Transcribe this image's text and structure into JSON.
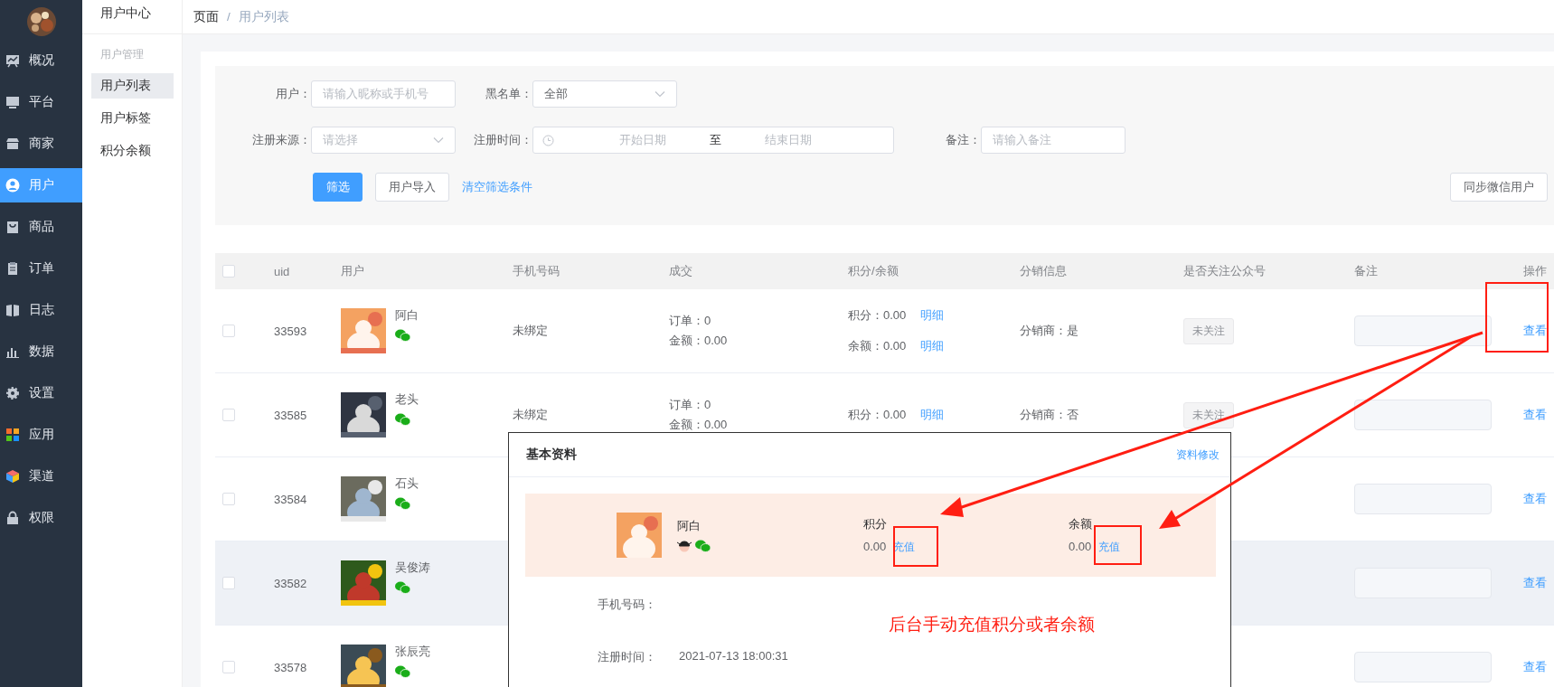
{
  "sidebar": {
    "items": [
      {
        "label": "概况",
        "kind": "chart",
        "selected": false
      },
      {
        "label": "平台",
        "kind": "monitor",
        "selected": false
      },
      {
        "label": "商家",
        "kind": "shop",
        "selected": false
      },
      {
        "label": "用户",
        "kind": "user",
        "selected": true
      },
      {
        "label": "商品",
        "kind": "bag",
        "selected": false
      },
      {
        "label": "订单",
        "kind": "clipboard",
        "selected": false
      },
      {
        "label": "日志",
        "kind": "book",
        "selected": false
      },
      {
        "label": "数据",
        "kind": "bars",
        "selected": false
      },
      {
        "label": "设置",
        "kind": "gear",
        "selected": false
      },
      {
        "label": "应用",
        "kind": "apps",
        "selected": false
      },
      {
        "label": "渠道",
        "kind": "cube",
        "selected": false
      },
      {
        "label": "权限",
        "kind": "lock",
        "selected": false
      }
    ]
  },
  "submenu": {
    "title": "用户中心",
    "group": "用户管理",
    "items": [
      {
        "label": "用户列表",
        "selected": true
      },
      {
        "label": "用户标签",
        "selected": false
      },
      {
        "label": "积分余额",
        "selected": false
      }
    ]
  },
  "breadcrumb": {
    "items": [
      "页面",
      "用户列表"
    ],
    "separator": "/"
  },
  "filters": {
    "rows": [
      [
        {
          "label": "用户：",
          "kind": "input",
          "placeholder": "请输入昵称或手机号"
        },
        {
          "label": "黑名单：",
          "kind": "select",
          "value": "全部"
        }
      ],
      [
        {
          "label": "注册来源：",
          "kind": "select",
          "placeholder": "请选择"
        },
        {
          "label": "注册时间：",
          "kind": "daterange",
          "start_placeholder": "开始日期",
          "separator": "至",
          "end_placeholder": "结束日期"
        },
        {
          "label": "备注：",
          "kind": "input",
          "placeholder": "请输入备注"
        }
      ]
    ],
    "buttons": [
      {
        "label": "筛选",
        "kind": "primary"
      },
      {
        "label": "用户导入",
        "kind": "default"
      },
      {
        "label": "清空筛选条件",
        "kind": "link"
      }
    ],
    "sync_button": "同步微信用户"
  },
  "table": {
    "select_all": {
      "checked": false
    },
    "columns": [
      "uid",
      "用户",
      "手机号码",
      "成交",
      "积分/余额",
      "分销信息",
      "是否关注公众号",
      "备注",
      "操作"
    ],
    "rows": [
      {
        "checked": false,
        "hovered": false,
        "uid": "33593",
        "name": "阿白",
        "phone": "未绑定",
        "orders": "订单：0",
        "amount": "金额：0.00",
        "points": "积分：0.00",
        "points_link": "明细",
        "balance": "余额：0.00",
        "balance_link": "明细",
        "distribution": "分销商：是",
        "follow": "未关注",
        "action": "查看"
      },
      {
        "checked": false,
        "hovered": false,
        "uid": "33585",
        "name": "老头",
        "phone": "未绑定",
        "orders": "订单：0",
        "amount": "金额：0.00",
        "points": "积分：0.00",
        "points_link": "明细",
        "distribution": "分销商：否",
        "follow": "未关注",
        "action": "查看"
      },
      {
        "checked": false,
        "hovered": false,
        "uid": "33584",
        "name": "石头",
        "action": "查看"
      },
      {
        "checked": false,
        "hovered": true,
        "uid": "33582",
        "name": "吴俊涛",
        "action": "查看"
      },
      {
        "checked": false,
        "hovered": false,
        "uid": "33578",
        "name": "张辰亮",
        "action": "查看"
      }
    ]
  },
  "profile_popup": {
    "title": "基本资料",
    "edit_link": "资料修改",
    "name": "阿白",
    "points_label": "积分",
    "points_value": "0.00",
    "points_action": "充值",
    "balance_label": "余额",
    "balance_value": "0.00",
    "balance_action": "充值",
    "phone_label": "手机号码：",
    "register_label": "注册时间：",
    "register_value": "2021-07-13 18:00:31"
  },
  "annotation": {
    "text": "后台手动充值积分或者余额"
  }
}
